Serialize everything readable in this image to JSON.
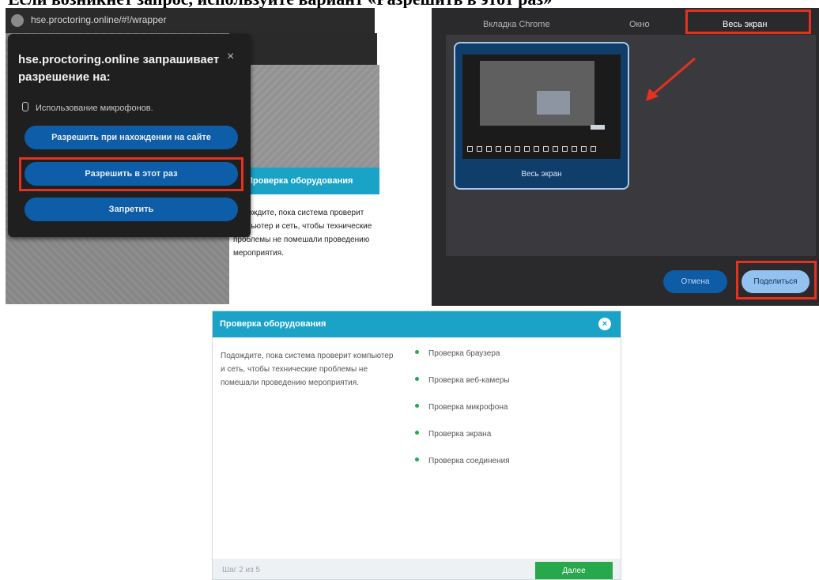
{
  "top_heading": "Если возникнет запрос, используйте вариант «Разрешить в этот раз»",
  "browser_panel": {
    "url": "hse.proctoring.online/#!/wrapper",
    "permission_popup": {
      "title": "hse.proctoring.online запрашивает разрешение на:",
      "close_glyph": "×",
      "permission_item": "Использование микрофонов.",
      "buttons": [
        "Разрешить при нахождении на сайте",
        "Разрешить в этот раз",
        "Запретить"
      ],
      "highlighted_button_index": 1
    },
    "background_modal": {
      "title": "Проверка оборудования",
      "text": "Подождите, пока система проверит компьютер и сеть, чтобы технические проблемы не помешали проведению мероприятия."
    }
  },
  "share_panel": {
    "tabs": [
      "Вкладка Chrome",
      "Окно",
      "Весь экран"
    ],
    "selected_tab_index": 2,
    "thumbnail_label": "Весь экран",
    "buttons": {
      "cancel": "Отмена",
      "share": "Поделиться"
    },
    "accent_color": "#e8301e"
  },
  "check_dialog": {
    "title": "Проверка оборудования",
    "close_glyph": "×",
    "description": "Подождите, пока система проверит компьютер и сеть, чтобы технические проблемы не помешали проведению мероприятия.",
    "checks": [
      "Проверка браузера",
      "Проверка веб-камеры",
      "Проверка микрофона",
      "Проверка экрана",
      "Проверка соединения"
    ],
    "status_color": "#27a84a",
    "step": "Шаг 2 из 5",
    "next_button": "Далее"
  }
}
